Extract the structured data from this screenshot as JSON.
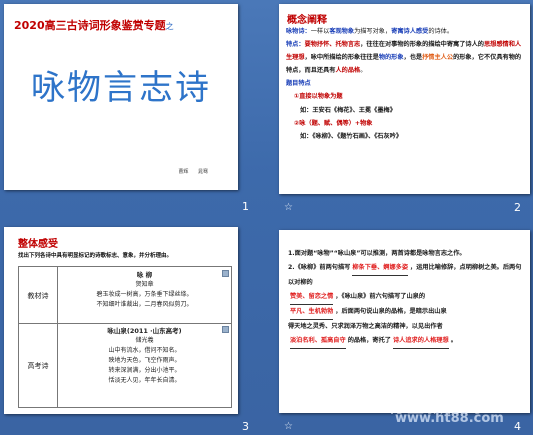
{
  "slides": [
    {
      "number": "1",
      "title": "2020高三古诗词形象鉴赏专题",
      "title_suffix": "之",
      "main_heading": "咏物言志诗",
      "author_line": "曹辉 晁骞"
    },
    {
      "number": "2",
      "heading": "概念阐释",
      "lines": [
        {
          "label": "咏物诗：",
          "text": "一样以",
          "hl": "客观物象",
          "after": "为描写对象，",
          "hl2": "寄寓诗人感受",
          "after2": "的诗体。"
        },
        {
          "label": "特点：",
          "hl": "要物抒怀、托物言志",
          "text": "，往往在对事物的形象的描绘中寄寓了诗人的",
          "hl2": "思想感情和人生理想",
          "after": "，咏中所描绘的形象往往是",
          "hl3": "物的形象",
          "after2": "，也是",
          "hl4": "抒情主人公",
          "after3": "的形象，它不仅具有物的特点，而且还具有",
          "hl5": "人的品格",
          "after4": "。"
        },
        {
          "label": "题目特点"
        },
        {
          "mark": "①直接以物象为题"
        },
        {
          "text": "如：王安石《梅花》、王冕《墨梅》"
        },
        {
          "mark": "②咏（题、赋、偶等）+物象"
        },
        {
          "text": "如：《咏柳》、《题竹石画》、《石灰吟》"
        }
      ]
    },
    {
      "number": "3",
      "heading": "整体感受",
      "instruction": "找出下列各诗中具有明显标记的诗歌标志、意象，并分析理由。",
      "rows": [
        {
          "label": "教材诗",
          "title": "咏 柳",
          "author": "贺知章",
          "lines": [
            "碧玉妆成一树高，万条垂下绿丝绦。",
            "不知细叶谁裁出，二月春风似剪刀。"
          ]
        },
        {
          "label": "高考诗",
          "title": "咏山泉(2011 ·山东高考)",
          "author": "储光羲",
          "lines": [
            "山中有流水，借问不知名。",
            "映地为天色，飞空作雨声。",
            "转来深涧满，分出小池平。",
            "恬淡无人见，年年长自清。"
          ]
        }
      ]
    },
    {
      "number": "4",
      "lines": [
        {
          "text": "1.面对题“咏物”“咏山泉”可以推测，两首诗都是咏物言志之作。"
        },
        {
          "text": "2.《咏柳》前两句描写",
          "blank": "柳条下垂、婀娜多姿",
          "after": "，运用比喻修辞，点明柳树之美。后两句以对柳的"
        },
        {
          "blank": "赞美、留恋之情",
          "after": "，《咏山泉》前六句描写了山泉的"
        },
        {
          "blank": "平凡、生机勃勃",
          "after": "，后面两句说山泉的品格，是暗示出山泉"
        },
        {
          "text": "得天地之灵秀、只求润泽万物之高洁的精神，以见出作者"
        },
        {
          "blank": "淡泊名利、孤高自守",
          "after": "的品格，寄托了",
          "blank2": "诗人追求的人格理想",
          "after2": "。"
        }
      ]
    }
  ],
  "watermark": {
    "line1": "育星教育网",
    "line2": "www.ht88.com"
  }
}
